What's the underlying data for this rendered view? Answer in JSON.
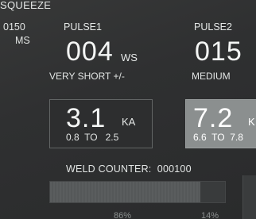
{
  "squeeze": {
    "label": "SQUEEZE",
    "value": "0150",
    "unit": "MS"
  },
  "pulse1": {
    "title": "PULSE1",
    "value": "004",
    "unit": "WS",
    "description": "VERY SHORT +/-"
  },
  "pulse2": {
    "title": "PULSE2",
    "value": "015",
    "description": "MEDIUM"
  },
  "current1": {
    "value": "3.1",
    "unit": "KA",
    "range": "0.8  TO   2.5"
  },
  "current2": {
    "value": "7.2",
    "unit": "K",
    "range": "6.6  TO  7.8"
  },
  "weld_counter": {
    "label": "WELD COUNTER:",
    "value": "000100",
    "text": "WELD COUNTER:  000100"
  },
  "split_bar": {
    "pulse1_percent": 86,
    "pulse2_percent": 14,
    "pulse1_label": "86%",
    "pulse2_label": "14%"
  },
  "colors": {
    "background": "#2f3031",
    "selected_box": "#8b8f8f",
    "box_border": "#626565",
    "text": "#ecefee"
  }
}
